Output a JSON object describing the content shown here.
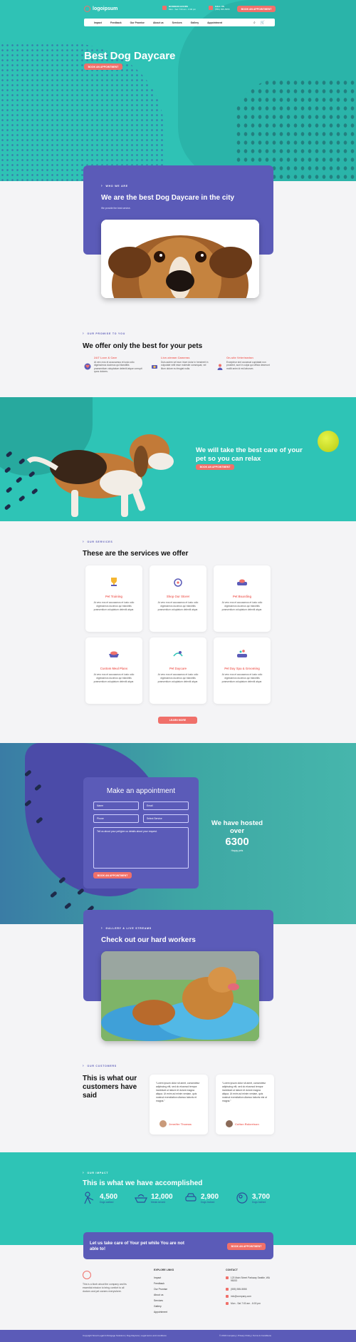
{
  "brand": {
    "name": "logoipsum"
  },
  "header": {
    "hours": {
      "title": "BUSINESS HOURS",
      "value": "Mon - Sat 7:00 am - 6:00 pm"
    },
    "phone": {
      "title": "CALL US",
      "value": "(555) 555-5555"
    },
    "appointment_label": "BOOK AN APPOINTMENT"
  },
  "nav": {
    "items": [
      "Impact",
      "Feedback",
      "Our Promise",
      "About us",
      "Services",
      "Gallery",
      "Appointment"
    ]
  },
  "hero": {
    "title": "Best Dog Daycare",
    "button": "BOOK AN APPOINTMENT"
  },
  "who": {
    "eyebrow": "WHO WE ARE",
    "title": "We are the best Dog Daycare in the city",
    "subtitle": "We provide the best service."
  },
  "promise": {
    "eyebrow": "OUR PROMISE TO YOU",
    "title": "We offer only the best for your pets",
    "items": [
      {
        "title": "24/7 Love & Care",
        "text": "At vero eos et accusamus et iusto odio dignissimos ducimus qui blanditiis praesentium voluptatum deleniti atque corrupti quos dolores."
      },
      {
        "title": "Live-stream Cameras",
        "text": "Duis autem vel eum iriure dolor in hendrerit in vulputate velit esse molestie consequat, vel illum dolore eu feugiat nulla."
      },
      {
        "title": "On-site Veterinarian",
        "text": "Excepteur sint occaecat cupidatat non proident, sunt in culpa qui officia deserunt mollit anim id est laborum."
      }
    ]
  },
  "care": {
    "title": "We will take the best care of your pet so you can relax",
    "button": "BOOK AN APPOINTMENT"
  },
  "services": {
    "eyebrow": "OUR SERVICES",
    "title": "These are the services we offer",
    "items": [
      {
        "title": "Pet Training",
        "text": "At vero eos et accusamus et iusto odio dignissimos ducimus qui blanditiis praesentium voluptatum deleniti atque."
      },
      {
        "title": "Shop Our Store!",
        "text": "At vero eos et accusamus et iusto odio dignissimos ducimus qui blanditiis praesentium voluptatum deleniti atque."
      },
      {
        "title": "Pet Boarding",
        "text": "At vero eos et accusamus et iusto odio dignissimos ducimus qui blanditiis praesentium voluptatum deleniti atque."
      },
      {
        "title": "Custom Meal Plans",
        "text": "At vero eos et accusamus et iusto odio dignissimos ducimus qui blanditiis praesentium voluptatum deleniti atque."
      },
      {
        "title": "Pet Daycare",
        "text": "At vero eos et accusamus et iusto odio dignissimos ducimus qui blanditiis praesentium voluptatum deleniti atque."
      },
      {
        "title": "Pet Day Spa & Grooming",
        "text": "At vero eos et accusamus et iusto odio dignissimos ducimus qui blanditiis praesentium voluptatum deleniti atque."
      }
    ],
    "button": "LEARN MORE"
  },
  "appointment": {
    "title": "Make an appointment",
    "name_placeholder": "Name",
    "email_placeholder": "Email",
    "phone_placeholder": "Phone",
    "service_placeholder": "Select Service",
    "message_placeholder": "Tell us about your pet/give us details about your request.",
    "submit": "BOOK AN APPOINTMENT",
    "hosted_line": "We have hosted over",
    "hosted_number": "6300",
    "hosted_caption": "Happy pets"
  },
  "gallery": {
    "eyebrow": "GALLERY & LIVE STREAMS",
    "title": "Check out our hard workers"
  },
  "customers": {
    "eyebrow": "OUR CUSTOMERS",
    "title": "This is what our customers have said",
    "items": [
      {
        "quote": "“Lorem ipsum dolor sit amet, consectetur adipiscing elit, sed do eiusmod tempor incididunt ut labore et dolore magna aliqua. Ut enim ad minim veniam, quis nostrud exercitation ullamco laboris et magna.”",
        "name": "Jennifer Thomas"
      },
      {
        "quote": "“Lorem ipsum dolor sit amet, consectetur adipiscing elit, sed do eiusmod tempor incididunt ut labore et dolore magna aliqua. Ut enim ad minim veniam, quis nostrud exercitation ullamco laboris nisi ut magna.”",
        "name": "Colton Robertson"
      }
    ]
  },
  "impact": {
    "eyebrow": "OUR IMPACT",
    "title": "This is what we have accomplished",
    "stats": [
      {
        "value": "4,500",
        "label": "Dogs walked"
      },
      {
        "value": "12,000",
        "label": "Meals served"
      },
      {
        "value": "2,900",
        "label": "Dogs trained"
      },
      {
        "value": "3,700",
        "label": "Dogs bathed"
      }
    ]
  },
  "cta": {
    "text": "Let us take care of Your pet while You are not able to!",
    "button": "BOOK AN APPOINTMENT"
  },
  "footer": {
    "about": "This is a blurb about the company and its essential mission to bring comfort to all doctors and pet owners everywhere.",
    "links_title": "EXPLORE LINKS",
    "links": [
      "Impact",
      "Feedback",
      "Our Promise",
      "About us",
      "Services",
      "Gallery",
      "Appointment"
    ],
    "contact_title": "CONTACT",
    "contact": [
      "123 Main Street Parkway Seattle, WA 98153",
      "(555) 555-5555",
      "info@company.com",
      "Mon - Sat 7:00 am - 6:00 pm"
    ],
    "copyright": "Copyright Smart Legal & Mortgage Solutions | Dog-Daycare | Legal terms and conditions",
    "legal": "© 2019 Company | Privacy Policy | Terms & Conditions"
  },
  "colors": {
    "teal": "#2ec4b6",
    "purple": "#5b5bb8",
    "coral": "#f0706a"
  }
}
